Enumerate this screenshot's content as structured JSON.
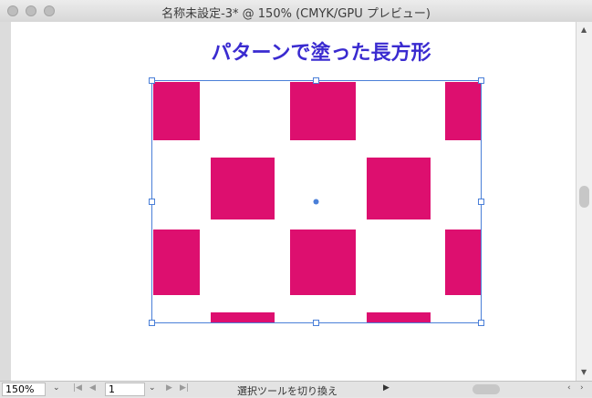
{
  "window": {
    "title": "名称未設定-3* @ 150% (CMYK/GPU プレビュー)"
  },
  "artboard": {
    "heading": "パターンで塗った長方形"
  },
  "pattern": {
    "fill_color": "#dd0f6f"
  },
  "selection": {
    "color": "#4a7fd8"
  },
  "status": {
    "zoom": "150%",
    "page": "1",
    "tool_hint": "選択ツールを切り換え"
  }
}
